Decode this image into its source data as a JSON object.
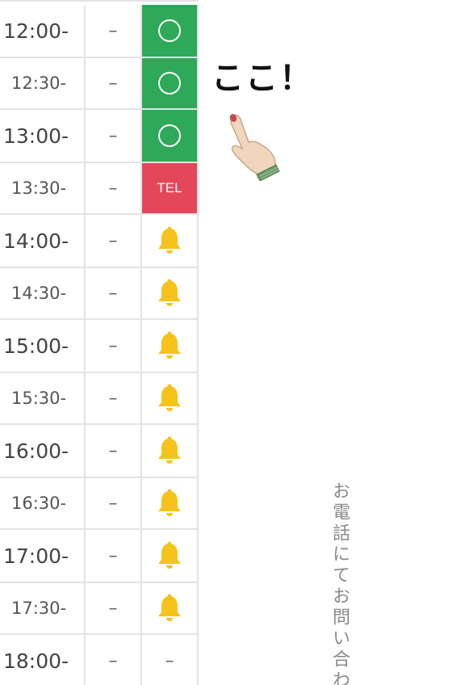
{
  "schedule": {
    "rows": [
      {
        "time": "12:00-",
        "dash": "–",
        "status": "available"
      },
      {
        "time": "12:30-",
        "dash": "–",
        "status": "available"
      },
      {
        "time": "13:00-",
        "dash": "–",
        "status": "available"
      },
      {
        "time": "13:30-",
        "dash": "–",
        "status": "tel",
        "label": "TEL"
      },
      {
        "time": "14:00-",
        "dash": "–",
        "status": "notify"
      },
      {
        "time": "14:30-",
        "dash": "–",
        "status": "notify"
      },
      {
        "time": "15:00-",
        "dash": "–",
        "status": "notify"
      },
      {
        "time": "15:30-",
        "dash": "–",
        "status": "notify"
      },
      {
        "time": "16:00-",
        "dash": "–",
        "status": "notify"
      },
      {
        "time": "16:30-",
        "dash": "–",
        "status": "notify"
      },
      {
        "time": "17:00-",
        "dash": "–",
        "status": "notify"
      },
      {
        "time": "17:30-",
        "dash": "–",
        "status": "notify"
      },
      {
        "time": "18:00-",
        "dash": "–",
        "status": "none",
        "label": "–"
      }
    ]
  },
  "annotation": {
    "text": "ここ！",
    "icon": "pointing-hand-icon"
  },
  "side_text": "お電話にてお問い合わ",
  "colors": {
    "available": "#2ea95a",
    "tel": "#e5475a",
    "bell": "#f6c21c"
  }
}
